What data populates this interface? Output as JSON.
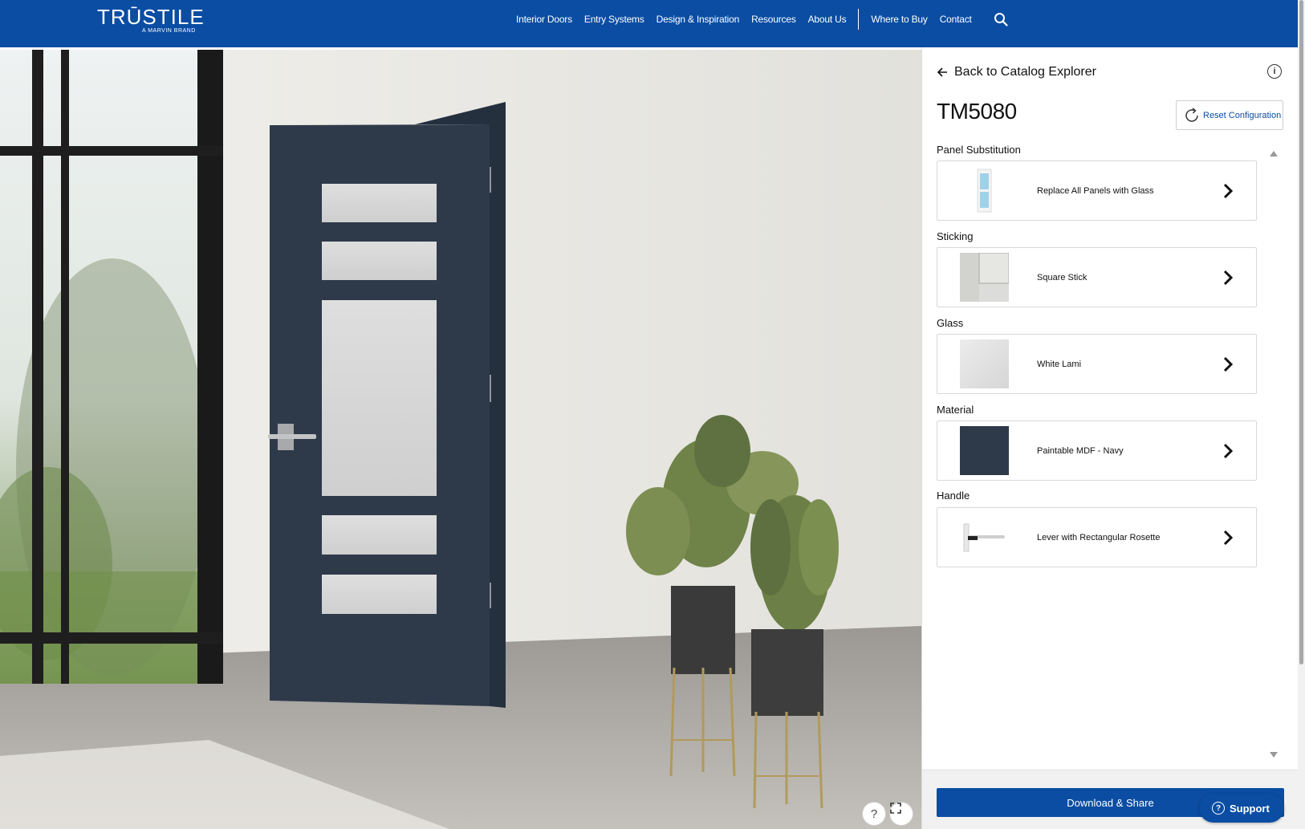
{
  "header": {
    "logo": "TRŪSTILE",
    "logo_sub": "A MARVIN BRAND",
    "nav": [
      "Interior Doors",
      "Entry Systems",
      "Design & Inspiration",
      "Resources",
      "About Us"
    ],
    "nav_secondary": [
      "Where to Buy",
      "Contact"
    ],
    "search_icon": "search-icon",
    "brand_color": "#0a4da3"
  },
  "panel": {
    "back_label": "Back to Catalog Explorer",
    "title": "TM5080",
    "reset_label": "Reset Configuration",
    "sections": [
      {
        "label": "Panel Substitution",
        "option": "Replace All Panels with Glass"
      },
      {
        "label": "Sticking",
        "option": "Square Stick"
      },
      {
        "label": "Glass",
        "option": "White Lami"
      },
      {
        "label": "Material",
        "option": "Paintable MDF - Navy"
      },
      {
        "label": "Handle",
        "option": "Lever with Rectangular Rosette"
      }
    ],
    "download_label": "Download & Share"
  },
  "scene": {
    "help_label": "?",
    "door_color": "#2e3a4a"
  },
  "support_label": "Support"
}
